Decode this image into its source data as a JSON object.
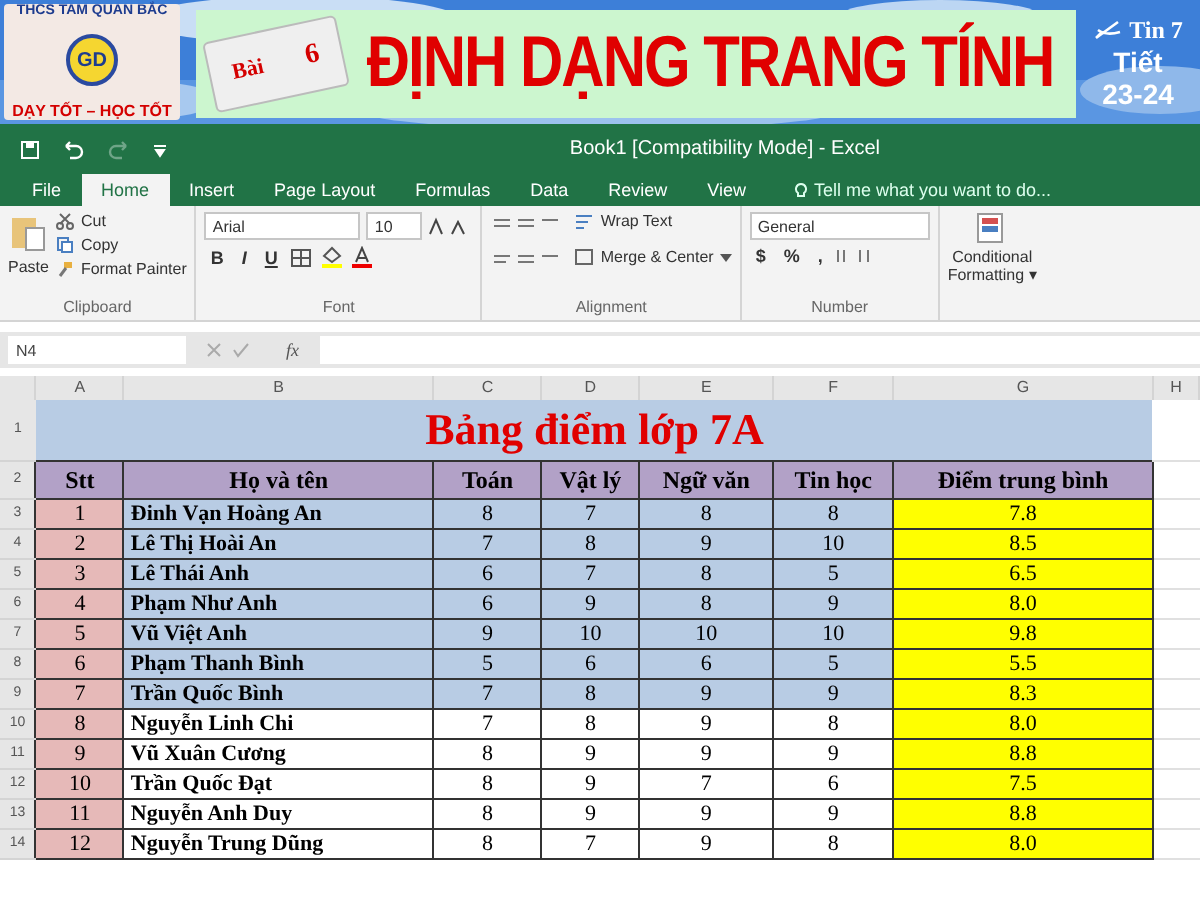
{
  "slide_header": {
    "logo": {
      "top_text": "THCS TAM QUAN BẮC",
      "badge": "GD",
      "bottom_text": "DẠY TỐT – HỌC TỐT"
    },
    "lesson_badge": {
      "label": "Bài",
      "number": "6"
    },
    "title": "ĐỊNH DẠNG TRANG TÍNH",
    "subject": "Tin 7",
    "period_label": "Tiết",
    "period": "23-24"
  },
  "excel": {
    "title": "Book1  [Compatibility Mode] - Excel",
    "tabs": [
      {
        "label": "File",
        "selected": false
      },
      {
        "label": "Home",
        "selected": true
      },
      {
        "label": "Insert",
        "selected": false
      },
      {
        "label": "Page Layout",
        "selected": false
      },
      {
        "label": "Formulas",
        "selected": false
      },
      {
        "label": "Data",
        "selected": false
      },
      {
        "label": "Review",
        "selected": false
      },
      {
        "label": "View",
        "selected": false
      }
    ],
    "tell_me": {
      "placeholder": "Tell me what you want to do..."
    },
    "clipboard": {
      "paste": "Paste",
      "cut": "Cut",
      "copy": "Copy",
      "format_painter": "Format Painter",
      "label": "Clipboard"
    },
    "font": {
      "family": "Arial",
      "size": "10",
      "styles": [
        "B",
        "I",
        "U"
      ],
      "label": "Font"
    },
    "alignment": {
      "wrap": "Wrap Text",
      "merge": "Merge & Center",
      "label": "Alignment"
    },
    "number": {
      "format": "General",
      "symbols": [
        "$",
        "%",
        ","
      ],
      "label": "Number"
    },
    "styles": {
      "conditional": [
        "Conditional",
        "Formatting ▾"
      ]
    },
    "name_box": "N4",
    "fx": "fx",
    "sheet": {
      "columns": [
        "A",
        "B",
        "C",
        "D",
        "E",
        "F",
        "G",
        "H"
      ],
      "title": {
        "row_number": "1",
        "text": "Bảng điểm lớp 7A"
      },
      "header": {
        "row_number": "2",
        "cells": [
          "Stt",
          "Họ và tên",
          "Toán",
          "Vật lý",
          "Ngữ văn",
          "Tin học",
          "Điểm trung bình"
        ]
      },
      "rows": [
        {
          "row_number": "3",
          "stt": "1",
          "name": "Đinh Vạn Hoàng An",
          "scores": [
            "8",
            "7",
            "8",
            "8"
          ],
          "average": "7.8",
          "shaded": true
        },
        {
          "row_number": "4",
          "stt": "2",
          "name": "Lê Thị Hoài An",
          "scores": [
            "7",
            "8",
            "9",
            "10"
          ],
          "average": "8.5",
          "shaded": true
        },
        {
          "row_number": "5",
          "stt": "3",
          "name": "Lê Thái Anh",
          "scores": [
            "6",
            "7",
            "8",
            "5"
          ],
          "average": "6.5",
          "shaded": true
        },
        {
          "row_number": "6",
          "stt": "4",
          "name": "Phạm Như Anh",
          "scores": [
            "6",
            "9",
            "8",
            "9"
          ],
          "average": "8.0",
          "shaded": true
        },
        {
          "row_number": "7",
          "stt": "5",
          "name": "Vũ Việt Anh",
          "scores": [
            "9",
            "10",
            "10",
            "10"
          ],
          "average": "9.8",
          "shaded": true
        },
        {
          "row_number": "8",
          "stt": "6",
          "name": "Phạm Thanh Bình",
          "scores": [
            "5",
            "6",
            "6",
            "5"
          ],
          "average": "5.5",
          "shaded": true
        },
        {
          "row_number": "9",
          "stt": "7",
          "name": "Trần Quốc Bình",
          "scores": [
            "7",
            "8",
            "9",
            "9"
          ],
          "average": "8.3",
          "shaded": true
        },
        {
          "row_number": "10",
          "stt": "8",
          "name": "Nguyễn Linh Chi",
          "scores": [
            "7",
            "8",
            "9",
            "8"
          ],
          "average": "8.0",
          "shaded": false
        },
        {
          "row_number": "11",
          "stt": "9",
          "name": "Vũ Xuân Cương",
          "scores": [
            "8",
            "9",
            "9",
            "9"
          ],
          "average": "8.8",
          "shaded": false
        },
        {
          "row_number": "12",
          "stt": "10",
          "name": "Trần Quốc Đạt",
          "scores": [
            "8",
            "9",
            "7",
            "6"
          ],
          "average": "7.5",
          "shaded": false
        },
        {
          "row_number": "13",
          "stt": "11",
          "name": "Nguyễn Anh Duy",
          "scores": [
            "8",
            "9",
            "9",
            "9"
          ],
          "average": "8.8",
          "shaded": false
        },
        {
          "row_number": "14",
          "stt": "12",
          "name": "Nguyễn Trung Dũng",
          "scores": [
            "8",
            "7",
            "9",
            "8"
          ],
          "average": "8.0",
          "shaded": false
        }
      ]
    }
  }
}
